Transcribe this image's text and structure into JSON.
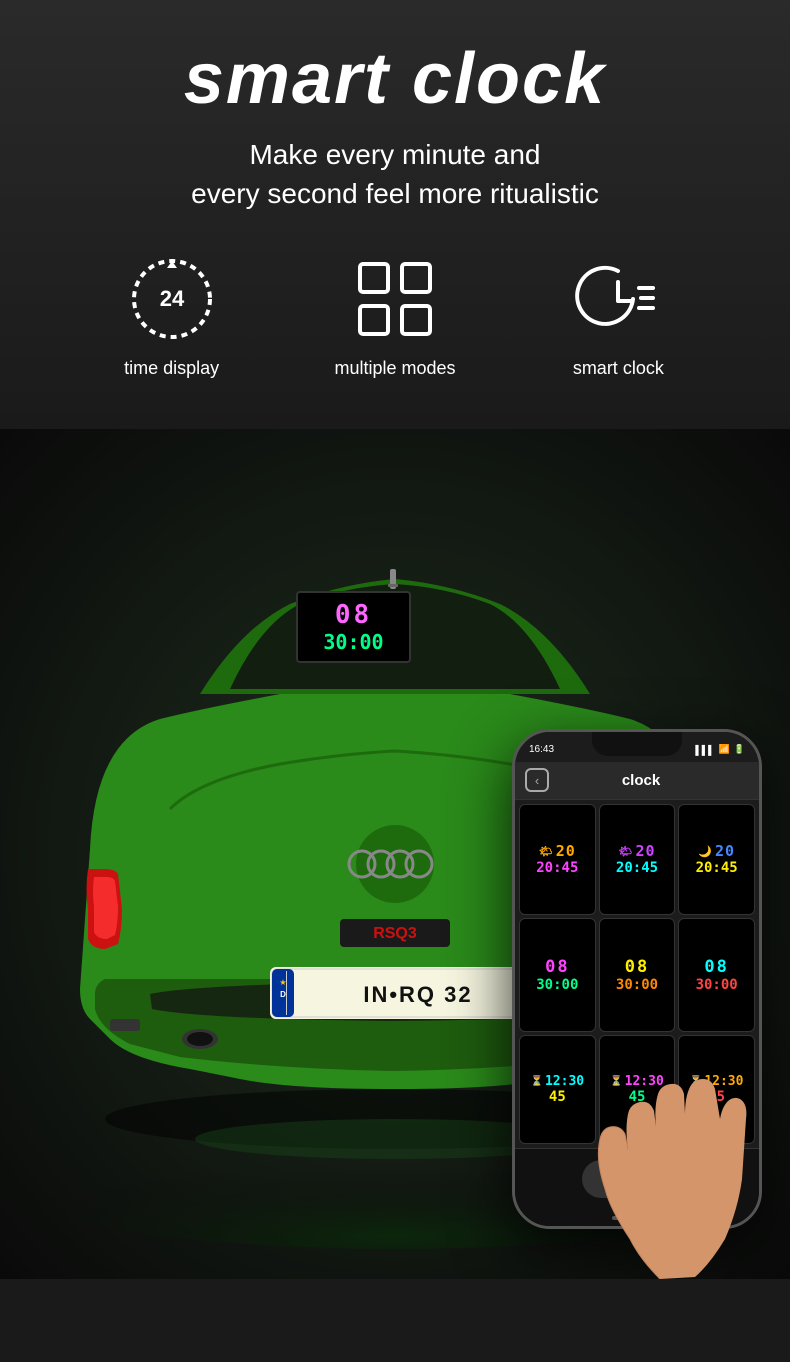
{
  "header": {
    "title": "smart clock",
    "subtitle_line1": "Make every minute and",
    "subtitle_line2": "every second feel more ritualistic"
  },
  "features": [
    {
      "id": "time-display",
      "label": "time display",
      "icon": "clock-24"
    },
    {
      "id": "multiple-modes",
      "label": "multiple modes",
      "icon": "grid-quad"
    },
    {
      "id": "smart-clock",
      "label": "smart clock",
      "icon": "clock-list"
    }
  ],
  "led_display": {
    "top": "08",
    "bottom": "30:00",
    "top_color": "#ff66ff"
  },
  "phone": {
    "status_time": "16:43",
    "nav_title": "clock",
    "clock_cells": [
      {
        "row1_icon": "🌤",
        "row1_text": "20",
        "row2": "20:45",
        "row1_color": "#ffaa00",
        "row2_color": "#ff44ff",
        "bg": "#000"
      },
      {
        "row1_icon": "🌤",
        "row1_text": "20",
        "row2": "20:45",
        "row1_color": "#cc44ff",
        "row2_color": "#00ffff",
        "bg": "#000"
      },
      {
        "row1_icon": "🌙",
        "row1_text": "20",
        "row2": "20:45",
        "row1_color": "#4488ff",
        "row2_color": "#ffee00",
        "bg": "#000"
      },
      {
        "row1_icon": "",
        "row1_text": "08",
        "row2": "30:00",
        "row1_color": "#ff44ff",
        "row2_color": "#00ff88",
        "bg": "#000"
      },
      {
        "row1_icon": "",
        "row1_text": "08",
        "row2": "30:00",
        "row1_color": "#ffee00",
        "row2_color": "#ff8800",
        "bg": "#000"
      },
      {
        "row1_icon": "",
        "row1_text": "08",
        "row2": "30:00",
        "row1_color": "#00ffff",
        "row2_color": "#ff4444",
        "bg": "#000"
      },
      {
        "row1_icon": "⏳",
        "row1_text": "12:30",
        "row2": "45",
        "row1_color": "#00ffff",
        "row2_color": "#ffee00",
        "bg": "#000"
      },
      {
        "row1_icon": "⏳",
        "row1_text": "12:30",
        "row2": "45",
        "row1_color": "#ff44ff",
        "row2_color": "#00ff88",
        "bg": "#000"
      },
      {
        "row1_icon": "⏳",
        "row1_text": "12:30",
        "row2": "45",
        "row1_color": "#ffaa00",
        "row2_color": "#ff4444",
        "bg": "#000"
      }
    ]
  }
}
